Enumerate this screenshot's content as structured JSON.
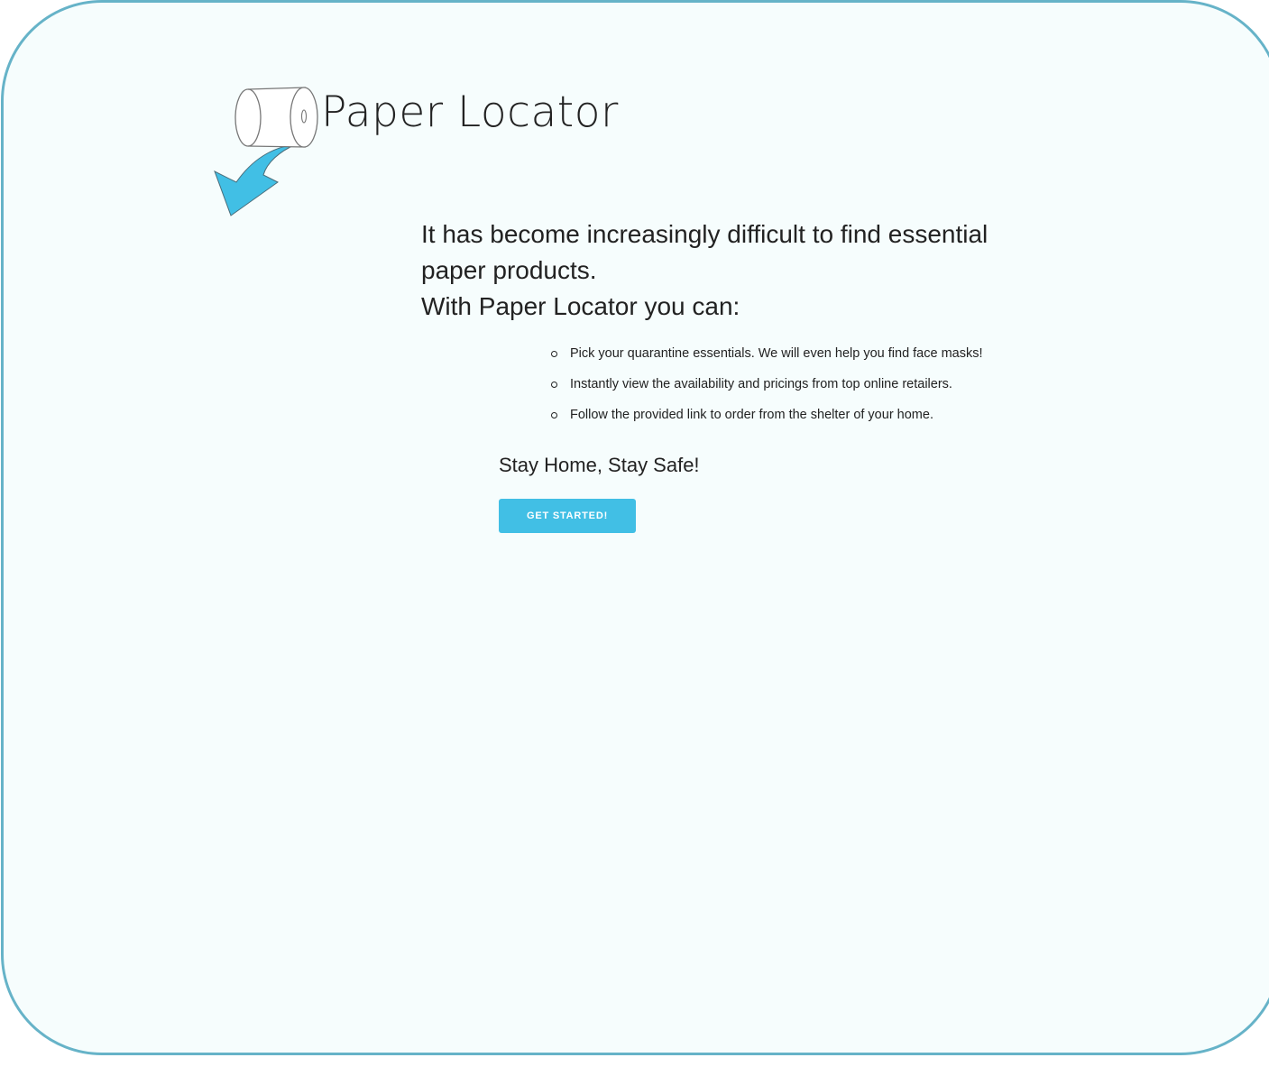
{
  "brand": {
    "title": "Paper Locator",
    "logo_icon": "toilet-paper-roll-arrow-icon"
  },
  "intro": {
    "line1": "It has become increasingly difficult to find essential paper products.",
    "line2": "With Paper Locator you can:"
  },
  "features": [
    {
      "text": "Pick your quarantine essentials. We will even help you find face masks!"
    },
    {
      "text": "Instantly view the availability and pricings from top online retailers."
    },
    {
      "text": "Follow the provided link to order from the shelter of your home."
    }
  ],
  "tagline": "Stay Home, Stay Safe!",
  "cta": {
    "label": "GET STARTED!"
  },
  "colors": {
    "accent": "#41bfe5",
    "frame_border": "#66b3c8",
    "background": "#f6fdfd",
    "text": "#222222"
  }
}
